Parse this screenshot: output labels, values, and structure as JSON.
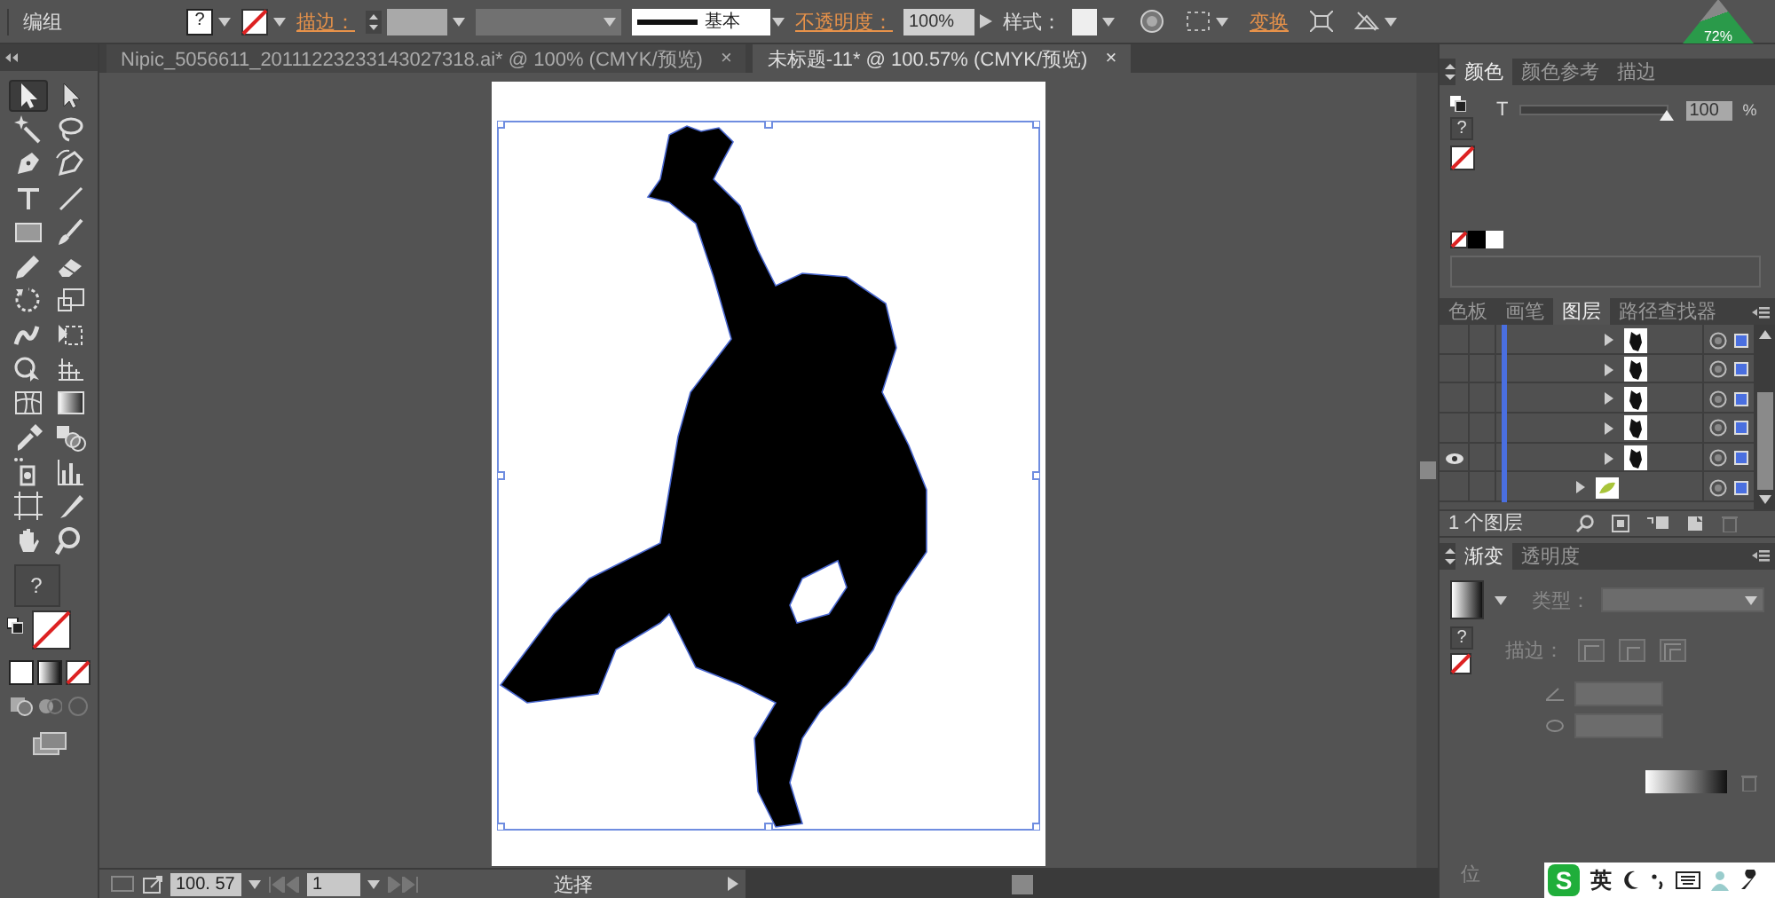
{
  "control_bar": {
    "selection_label": "编组",
    "fill_mark": "?",
    "stroke_link": "描边：",
    "brush_label": "基本",
    "opacity_link": "不透明度：",
    "opacity_value": "100%",
    "style_label": "样式：",
    "transform_link": "变换",
    "net_meter": "72%"
  },
  "toolbox": {
    "tools": [
      {
        "kind": "selection",
        "selected": true
      },
      {
        "kind": "direct-selection",
        "selected": false
      },
      {
        "kind": "magic-wand",
        "selected": false
      },
      {
        "kind": "lasso",
        "selected": false
      },
      {
        "kind": "pen",
        "selected": false
      },
      {
        "kind": "curvature",
        "selected": false
      },
      {
        "kind": "type",
        "selected": false
      },
      {
        "kind": "line",
        "selected": false
      },
      {
        "kind": "rectangle",
        "selected": false
      },
      {
        "kind": "brush",
        "selected": false
      },
      {
        "kind": "pencil",
        "selected": false
      },
      {
        "kind": "eraser",
        "selected": false
      },
      {
        "kind": "rotate",
        "selected": false
      },
      {
        "kind": "scale",
        "selected": false
      },
      {
        "kind": "warp",
        "selected": false
      },
      {
        "kind": "free-transform",
        "selected": false
      },
      {
        "kind": "shape-builder",
        "selected": false
      },
      {
        "kind": "perspective",
        "selected": false
      },
      {
        "kind": "mesh",
        "selected": false
      },
      {
        "kind": "gradient",
        "selected": false
      },
      {
        "kind": "eyedropper",
        "selected": false
      },
      {
        "kind": "blend",
        "selected": false
      },
      {
        "kind": "sprayer",
        "selected": false
      },
      {
        "kind": "graph",
        "selected": false
      },
      {
        "kind": "artboard",
        "selected": false
      },
      {
        "kind": "slice",
        "selected": false
      },
      {
        "kind": "hand",
        "selected": false
      },
      {
        "kind": "zoom",
        "selected": false
      }
    ],
    "fill_mark": "?"
  },
  "document_tabs": [
    {
      "title": "Nipic_5056611_20111223233143027318.ai* @ 100% (CMYK/预览)",
      "close": "×",
      "selected": false
    },
    {
      "title": "未标题-11* @ 100.57% (CMYK/预览)",
      "close": "×",
      "selected": true
    }
  ],
  "status_bar": {
    "zoom": "100. 57",
    "page": "1",
    "tool": "选择"
  },
  "color_panel": {
    "tabs": [
      {
        "label": "颜色",
        "selected": true
      },
      {
        "label": "颜色参考",
        "selected": false
      },
      {
        "label": "描边",
        "selected": false
      }
    ],
    "fill_mark": "?",
    "tint": {
      "label": "T",
      "level": 1,
      "value": "100",
      "unit": "%"
    }
  },
  "layers_panel": {
    "tabs": [
      {
        "label": "色板",
        "selected": false
      },
      {
        "label": "画笔",
        "selected": false
      },
      {
        "label": "图层",
        "selected": true
      },
      {
        "label": "路径查找器",
        "selected": false
      }
    ],
    "rows": [
      {
        "kind": "sublayer",
        "visible": false
      },
      {
        "kind": "sublayer",
        "visible": false
      },
      {
        "kind": "sublayer",
        "visible": false
      },
      {
        "kind": "sublayer",
        "visible": false
      },
      {
        "kind": "sublayer",
        "visible": true
      },
      {
        "kind": "group",
        "visible": false
      }
    ],
    "footer": "1 个图层"
  },
  "gradient_panel": {
    "tabs": [
      {
        "label": "渐变",
        "selected": true
      },
      {
        "label": "透明度",
        "selected": false
      }
    ],
    "type_label": "类型：",
    "stroke_label": "描边：",
    "fill_mark": "?",
    "position_label": "位"
  },
  "ime_bar": {
    "logo": "S",
    "mode": "英"
  }
}
